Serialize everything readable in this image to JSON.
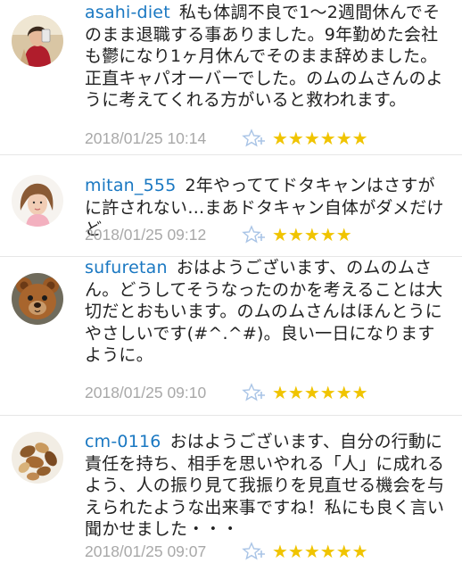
{
  "comments": [
    {
      "username": "asahi-diet",
      "text": "私も体調不良で1〜2週間休んでそのまま退職する事ありました。9年勤めた会社も鬱になり1ヶ月休んでそのまま辞めました。正直キャパオーバーでした。のムのムさんのように考えてくれる方がいると救われます。",
      "timestamp": "2018/01/25 10:14",
      "stars": "★★★★★★",
      "avatar": "woman-selfie-avatar"
    },
    {
      "username": "mitan_555",
      "text": "2年やっててドタキャンはさすがに許されない…まあドタキャン自体がダメだけど",
      "timestamp": "2018/01/25 09:12",
      "stars": "★★★★★",
      "avatar": "woman-portrait-avatar"
    },
    {
      "username": "sufuretan",
      "text": "おはようございます、のムのムさん。どうしてそうなったのかを考えることは大切だとおもいます。のムのムさんはほんとうにやさしいです(#^.^#)。良い一日になりますように。",
      "timestamp": "2018/01/25 09:10",
      "stars": "★★★★★★",
      "avatar": "teddy-bear-avatar"
    },
    {
      "username": "cm-0116",
      "text": "おはようございます、自分の行動に責任を持ち、相手を思いやれる「人」に成れるよう、人の振り見て我振りを見直せる機会を与えられたような出来事ですね！私にも良く言い聞かせました・・・",
      "timestamp": "2018/01/25 09:07",
      "stars": "★★★★★★",
      "avatar": "nuts-avatar"
    }
  ],
  "colors": {
    "username": "#1a78c2",
    "timestamp": "#a8a8a8",
    "star": "#f0c400",
    "add_star_icon": "#a9c4e6"
  }
}
